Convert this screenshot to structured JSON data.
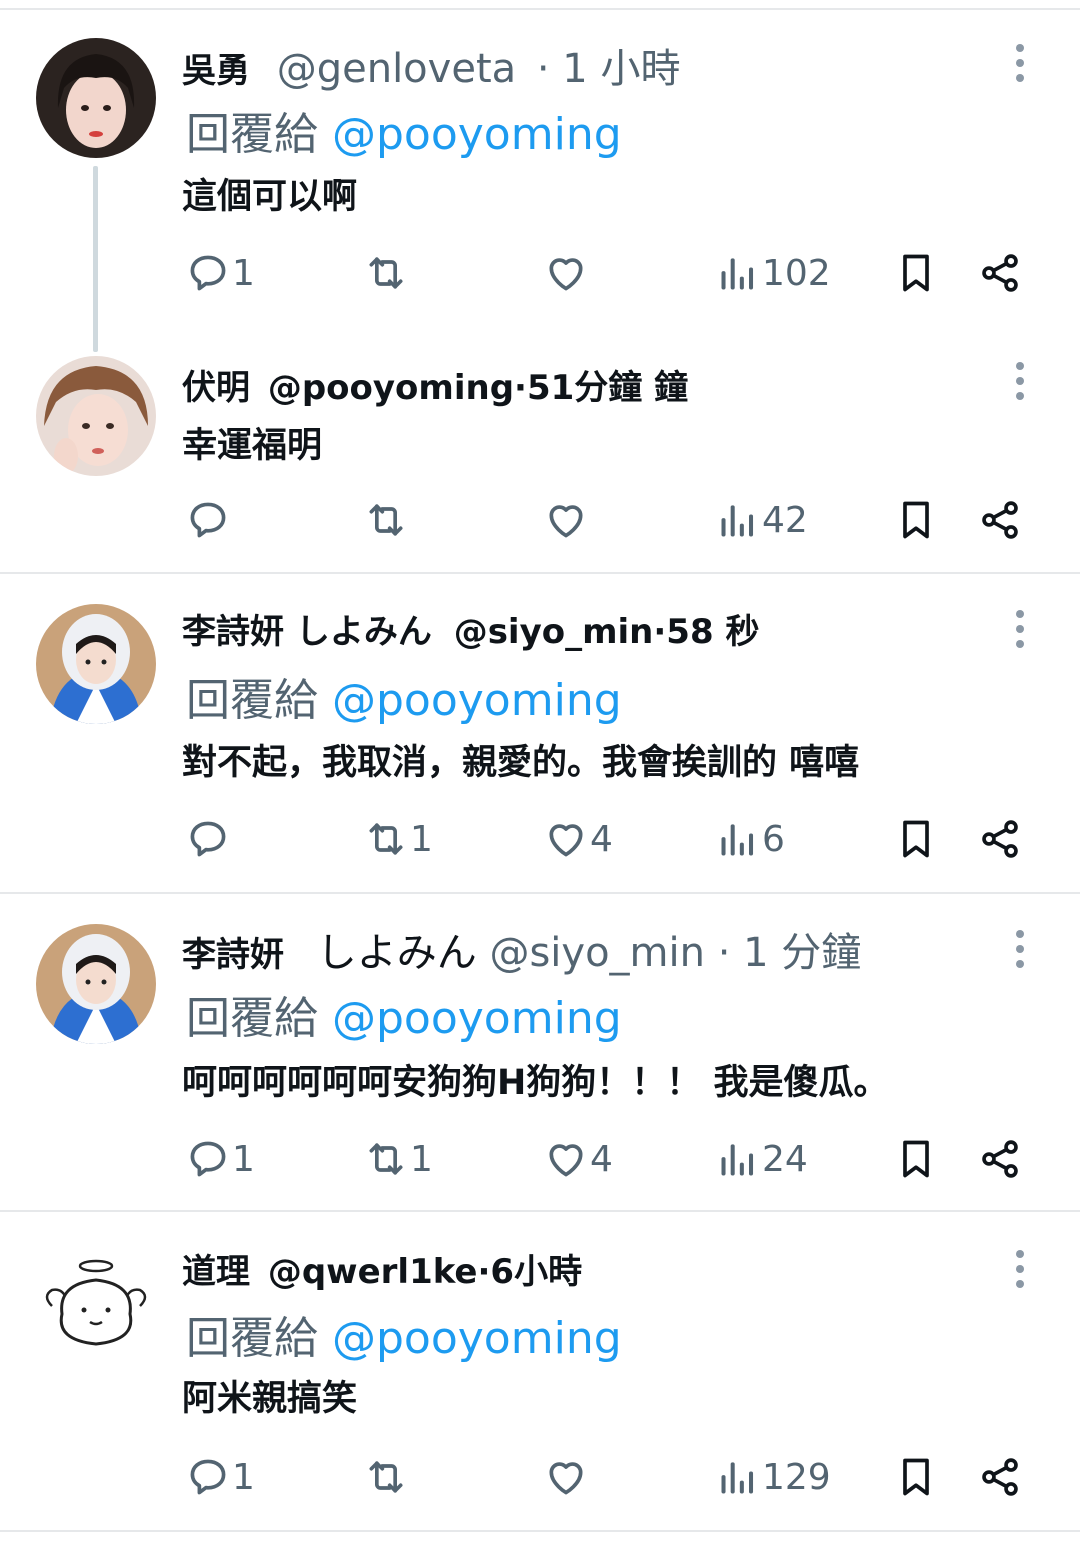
{
  "tweets": [
    {
      "name": "吳勇",
      "handle": "@genloveta",
      "time": "· 1 小時",
      "reply_label": "回覆給",
      "reply_handle": "@pooyoming",
      "text": "這個可以啊",
      "replies": "1",
      "retweets": "",
      "likes": "",
      "views": "102"
    },
    {
      "name": "伏明",
      "handle": "@pooyoming",
      "time": "·51分鐘 鐘",
      "text": "幸運福明",
      "replies": "",
      "retweets": "",
      "likes": "",
      "views": "42"
    },
    {
      "name": "李詩妍 しよみん",
      "handle": "@siyo_min",
      "time": "·58 秒",
      "reply_label": "回覆給",
      "reply_handle": "@pooyoming",
      "text": "對不起，我取消，親愛的。我會挨訓的 嘻嘻",
      "replies": "",
      "retweets": "1",
      "likes": "4",
      "views": "6"
    },
    {
      "name": "李詩妍",
      "name2": "しよみん",
      "handle": "@siyo_min",
      "time": "· 1 分鐘",
      "reply_label": "回覆給",
      "reply_handle": "@pooyoming",
      "text": "呵呵呵呵呵呵安狗狗H狗狗！！！ 我是傻瓜。",
      "replies": "1",
      "retweets": "1",
      "likes": "4",
      "views": "24"
    },
    {
      "name": "道理",
      "handle": "@qwerl1ke",
      "time": "·6小時",
      "reply_label": "回覆給",
      "reply_handle": "@pooyoming",
      "text": "阿米親搞笑",
      "replies": "1",
      "retweets": "",
      "likes": "",
      "views": "129"
    }
  ],
  "icons": {
    "reply": "comment-bubble-icon",
    "retweet": "retweet-icon",
    "like": "heart-icon",
    "views": "bar-chart-icon",
    "bookmark": "bookmark-icon",
    "share": "share-icon",
    "more": "more-vertical-icon"
  },
  "colors": {
    "text": "#0f1419",
    "secondary": "#536471",
    "link": "#1d9bf0",
    "divider": "#e6e8ea"
  }
}
